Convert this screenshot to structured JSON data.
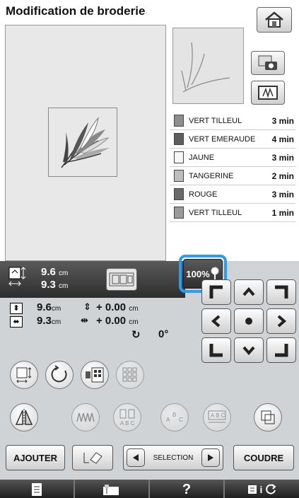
{
  "title": "Modification de broderie",
  "threads": [
    {
      "name": "VERT TILLEUL",
      "time": "3 min",
      "color": "#8e8e8e"
    },
    {
      "name": "VERT EMERAUDE",
      "time": "4 min",
      "color": "#5e5e5e"
    },
    {
      "name": "JAUNE",
      "time": "3 min",
      "color": "#f6f6f6"
    },
    {
      "name": "TANGERINE",
      "time": "2 min",
      "color": "#bdbdbd"
    },
    {
      "name": "ROUGE",
      "time": "3 min",
      "color": "#6a6a6a"
    },
    {
      "name": "VERT TILLEUL",
      "time": "1 min",
      "color": "#9a9a9a"
    }
  ],
  "size": {
    "width_val": "9.6",
    "height_val": "9.3",
    "unit": "cm"
  },
  "zoom_label": "100%",
  "info": {
    "height": "9.6",
    "width": "9.3",
    "unit": "cm",
    "offset_v": "+ 0.00",
    "offset_h": "+ 0.00",
    "rotation": "0°"
  },
  "buttons": {
    "add": "AJOUTER",
    "selection": "SELECTION",
    "sew": "COUDRE"
  },
  "bottom": {
    "help": "?",
    "info_glyph": "i"
  },
  "colors": {
    "panel": "#cfd3d6",
    "highlight": "#2a9df0",
    "dark_strip": "#3a3a3a"
  }
}
